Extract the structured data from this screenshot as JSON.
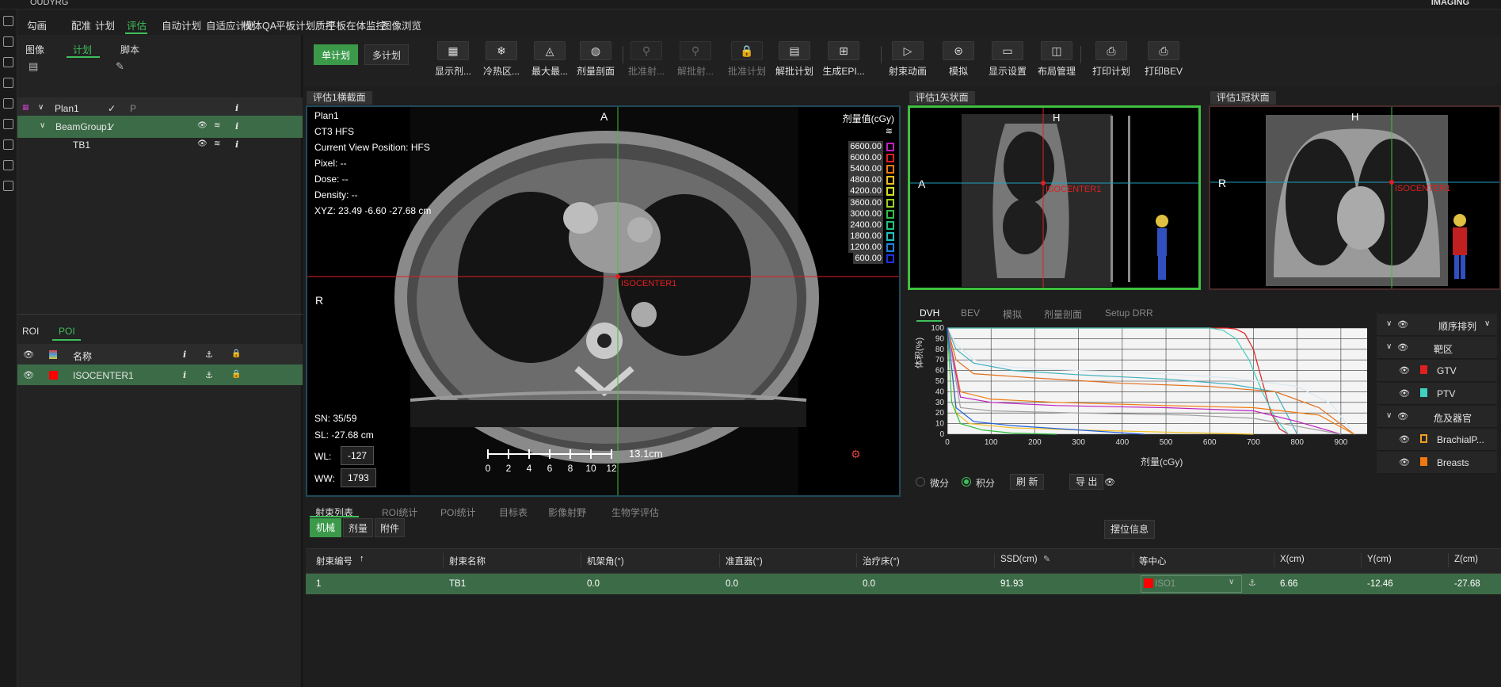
{
  "app": {
    "title": "OUDYRG"
  },
  "menu": [
    "勾画",
    "配准",
    "计划",
    "评估",
    "自动计划",
    "自适应计划",
    "模体QA",
    "平板计划质控",
    "平板在体监控",
    "图像浏览"
  ],
  "menu_active": 3,
  "left": {
    "tabs": [
      "图像",
      "计划",
      "脚本"
    ],
    "active_tab": 1,
    "tree": [
      {
        "label": "Plan1",
        "check": "✓",
        "info": "i"
      },
      {
        "label": "BeamGroup1",
        "check": "✓",
        "info": "i"
      },
      {
        "label": "TB1",
        "check": "",
        "info": "i"
      }
    ],
    "bottom_tabs": [
      "ROI",
      "POI"
    ],
    "poi_headers": {
      "name": "名称",
      "info": "i"
    },
    "poi_rows": [
      {
        "name": "ISOCENTER1",
        "color": "#ff0000"
      }
    ]
  },
  "toolbar": {
    "plan_modes": [
      "单计划",
      "多计划"
    ],
    "buttons": [
      {
        "label": "显示剂...",
        "glyph": "▦",
        "disabled": false
      },
      {
        "label": "冷热区...",
        "glyph": "❄",
        "disabled": false
      },
      {
        "label": "最大最...",
        "glyph": "◬",
        "disabled": false
      },
      {
        "label": "剂量剖面",
        "glyph": "◍",
        "disabled": false
      },
      {
        "label": "批准射...",
        "glyph": "⚲",
        "disabled": true
      },
      {
        "label": "解批射...",
        "glyph": "⚲",
        "disabled": true
      },
      {
        "label": "批准计划",
        "glyph": "🔒",
        "disabled": true
      },
      {
        "label": "解批计划",
        "glyph": "▤",
        "disabled": false
      },
      {
        "label": "生成EPI...",
        "glyph": "⊞",
        "disabled": false
      },
      {
        "label": "射束动画",
        "glyph": "▷",
        "disabled": false
      },
      {
        "label": "模拟",
        "glyph": "⊜",
        "disabled": false
      },
      {
        "label": "显示设置",
        "glyph": "▭",
        "disabled": false
      },
      {
        "label": "布局管理",
        "glyph": "◫",
        "disabled": false
      },
      {
        "label": "打印计划",
        "glyph": "⎙",
        "disabled": false
      },
      {
        "label": "打印BEV",
        "glyph": "⎙",
        "disabled": false
      }
    ]
  },
  "axial": {
    "label": "评估1横截面",
    "lines": [
      "Plan1",
      "CT3 HFS",
      "Current View Position: HFS",
      "Pixel:  --",
      "Dose:  --",
      "Density:  --",
      "XYZ: 23.49 -6.60 -27.68 cm"
    ],
    "top_marker": "A",
    "left_marker": "R",
    "isocenter": "ISOCENTER1",
    "sn": "SN: 35/59",
    "sl": "SL: -27.68 cm",
    "wl_label": "WL:",
    "wl": "-127",
    "ww_label": "WW:",
    "ww": "1793",
    "scale_ticks": [
      "0",
      "2",
      "4",
      "6",
      "8",
      "10",
      "12"
    ],
    "scale_label": "13.1cm",
    "dose_title": "剂量值(cGy)",
    "dose_levels": [
      {
        "v": "6600.00",
        "c": "#c020c0"
      },
      {
        "v": "6000.00",
        "c": "#e02020"
      },
      {
        "v": "5400.00",
        "c": "#f07a10"
      },
      {
        "v": "4800.00",
        "c": "#f0c020"
      },
      {
        "v": "4200.00",
        "c": "#d8e020"
      },
      {
        "v": "3600.00",
        "c": "#9ad020"
      },
      {
        "v": "3000.00",
        "c": "#30c040"
      },
      {
        "v": "2400.00",
        "c": "#20c080"
      },
      {
        "v": "1800.00",
        "c": "#20c0c0"
      },
      {
        "v": "1200.00",
        "c": "#2080e0"
      },
      {
        "v": "600.00",
        "c": "#2030e0"
      }
    ]
  },
  "sagittal": {
    "label": "评估1矢状面",
    "top_marker": "H",
    "left_marker": "A",
    "isocenter": "ISOCENTER1"
  },
  "coronal": {
    "label": "评估1冠状面",
    "top_marker": "H",
    "left_marker": "R",
    "isocenter": "ISOCENTER1"
  },
  "dvh": {
    "tabs": [
      "DVH",
      "BEV",
      "模拟",
      "剂量剖面",
      "Setup DRR"
    ],
    "active_tab": 0,
    "ylabel": "体积(%)",
    "xlabel": "剂量(cGy)",
    "options": [
      "微分",
      "积分"
    ],
    "selected_option": 1,
    "refresh": "刷 新",
    "export": "导 出",
    "legend": {
      "sort_label": "顺序排列",
      "group_target": "靶区",
      "group_oar": "危及器官",
      "items": [
        {
          "name": "GTV",
          "color": "#e02020"
        },
        {
          "name": "PTV",
          "color": "#40d0c0"
        },
        {
          "name": "BrachialP...",
          "color": "#f0a020",
          "hollow": true
        },
        {
          "name": "Breasts",
          "color": "#f07a10"
        }
      ]
    }
  },
  "chart_data": {
    "type": "line",
    "xlabel": "剂量(cGy)",
    "ylabel": "体积(%)",
    "xlim": [
      0,
      960
    ],
    "ylim": [
      0,
      100
    ],
    "xticks": [
      0,
      100,
      200,
      300,
      400,
      500,
      600,
      700,
      800,
      900
    ],
    "yticks": [
      0,
      10,
      20,
      30,
      40,
      50,
      60,
      70,
      80,
      90,
      100
    ],
    "grid": true,
    "series": [
      {
        "name": "GTV",
        "color": "#e02020",
        "x": [
          0,
          640,
          660,
          680,
          700,
          720,
          740,
          760,
          780
        ],
        "y": [
          100,
          100,
          99,
          95,
          80,
          50,
          20,
          5,
          0
        ]
      },
      {
        "name": "PTV",
        "color": "#40d0c0",
        "x": [
          0,
          600,
          630,
          660,
          690,
          720,
          750,
          780
        ],
        "y": [
          100,
          100,
          98,
          90,
          70,
          40,
          15,
          0
        ]
      },
      {
        "name": "",
        "color": "#d8e8f0",
        "x": [
          0,
          20,
          60,
          150,
          300,
          500,
          650,
          800,
          880,
          930
        ],
        "y": [
          100,
          85,
          70,
          63,
          60,
          57,
          53,
          45,
          28,
          0
        ]
      },
      {
        "name": "",
        "color": "#40b0c0",
        "x": [
          0,
          20,
          60,
          150,
          300,
          500,
          650,
          750,
          800
        ],
        "y": [
          100,
          80,
          67,
          60,
          56,
          52,
          47,
          40,
          0
        ]
      },
      {
        "name": "",
        "color": "#e07020",
        "x": [
          0,
          20,
          60,
          200,
          400,
          600,
          750,
          850,
          930
        ],
        "y": [
          100,
          70,
          57,
          53,
          48,
          45,
          40,
          25,
          0
        ]
      },
      {
        "name": "Breasts",
        "color": "#f07a10",
        "x": [
          0,
          30,
          100,
          250,
          500,
          700,
          850,
          930
        ],
        "y": [
          100,
          40,
          33,
          30,
          27,
          25,
          18,
          0
        ]
      },
      {
        "name": "",
        "color": "#c020c0",
        "x": [
          0,
          30,
          100,
          250,
          500,
          700,
          800,
          900
        ],
        "y": [
          100,
          35,
          30,
          27,
          25,
          22,
          12,
          0
        ]
      },
      {
        "name": "",
        "color": "#a0a0a0",
        "x": [
          0,
          30,
          100,
          300,
          550,
          700,
          900
        ],
        "y": [
          100,
          25,
          22,
          20,
          18,
          15,
          0
        ]
      },
      {
        "name": "BrachialP...",
        "color": "#f0c020",
        "x": [
          0,
          20,
          50,
          150,
          300,
          500,
          600,
          700
        ],
        "y": [
          100,
          20,
          10,
          6,
          4,
          2,
          1,
          0
        ]
      },
      {
        "name": "",
        "color": "#30c040",
        "x": [
          0,
          10,
          30,
          80,
          150,
          250
        ],
        "y": [
          100,
          30,
          10,
          4,
          1,
          0
        ]
      },
      {
        "name": "",
        "color": "#2060e0",
        "x": [
          0,
          20,
          60,
          150,
          300,
          450
        ],
        "y": [
          100,
          25,
          12,
          8,
          4,
          0
        ]
      }
    ]
  },
  "beam": {
    "tabs": [
      "射束列表",
      "ROI统计",
      "POI统计",
      "目标表",
      "影像射野",
      "生物学评估"
    ],
    "active_tab": 0,
    "subtabs": [
      "机械",
      "剂量",
      "附件"
    ],
    "setup_btn": "摆位信息",
    "headers": [
      "射束编号",
      "射束名称",
      "机架角(°)",
      "准直器(°)",
      "治疗床(°)",
      "SSD(cm)",
      "等中心",
      "X(cm)",
      "Y(cm)",
      "Z(cm)"
    ],
    "rows": [
      [
        "1",
        "TB1",
        "0.0",
        "0.0",
        "0.0",
        "91.93",
        "ISO1",
        "6.66",
        "-12.46",
        "-27.68"
      ]
    ]
  },
  "header_right": {
    "brand": "IMAGING"
  }
}
